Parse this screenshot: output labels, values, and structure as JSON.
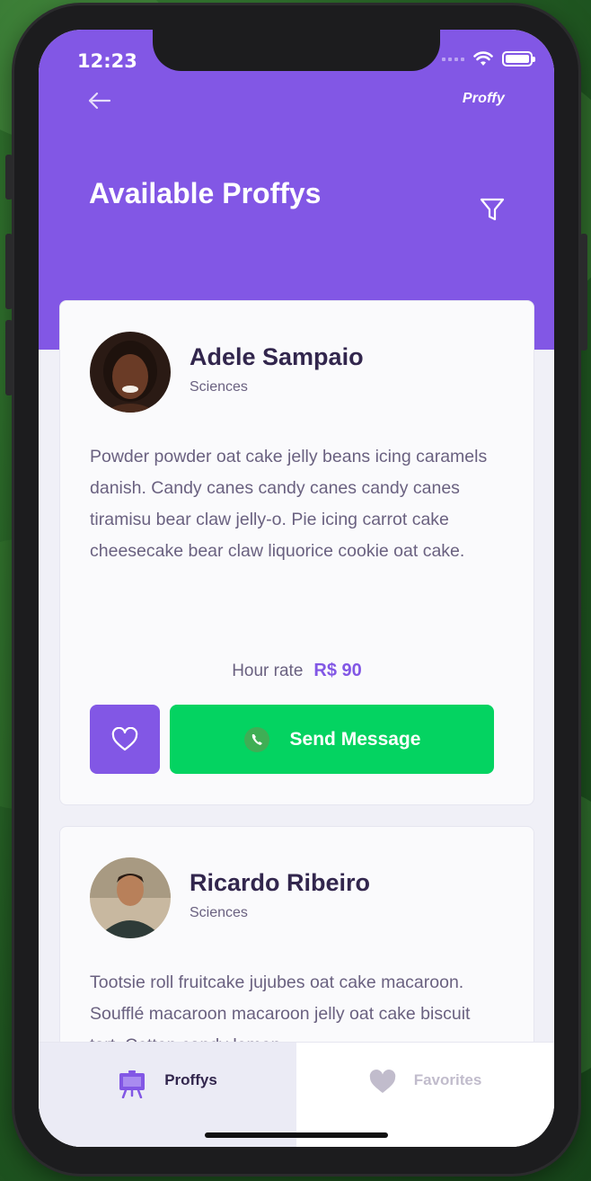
{
  "status_bar": {
    "time": "12:23"
  },
  "header": {
    "brand": "Proffy",
    "title": "Available Proffys"
  },
  "teachers": [
    {
      "name": "Adele Sampaio",
      "subject": "Sciences",
      "bio": "Powder powder oat cake jelly beans icing caramels danish. Candy canes candy canes candy canes tiramisu bear claw jelly-o. Pie icing carrot cake cheesecake bear claw liquorice cookie oat cake.",
      "price_label": "Hour rate",
      "price": "R$ 90",
      "message_label": "Send Message"
    },
    {
      "name": "Ricardo Ribeiro",
      "subject": "Sciences",
      "bio": "Tootsie roll fruitcake jujubes oat cake macaroon. Soufflé macaroon macaroon jelly oat cake biscuit tart. Cotton candy lemon"
    }
  ],
  "tabs": [
    {
      "label": "Proffys",
      "active": true
    },
    {
      "label": "Favorites",
      "active": false
    }
  ],
  "colors": {
    "primary": "#8257e5",
    "secondary": "#04d361",
    "title_text": "#32264d",
    "body_text": "#6a6180",
    "background": "#f0f0f7"
  },
  "icons": [
    "back-arrow-icon",
    "filter-icon",
    "heart-icon",
    "whatsapp-icon",
    "easel-icon",
    "wifi-icon",
    "battery-icon",
    "cellular-signal-icon"
  ]
}
